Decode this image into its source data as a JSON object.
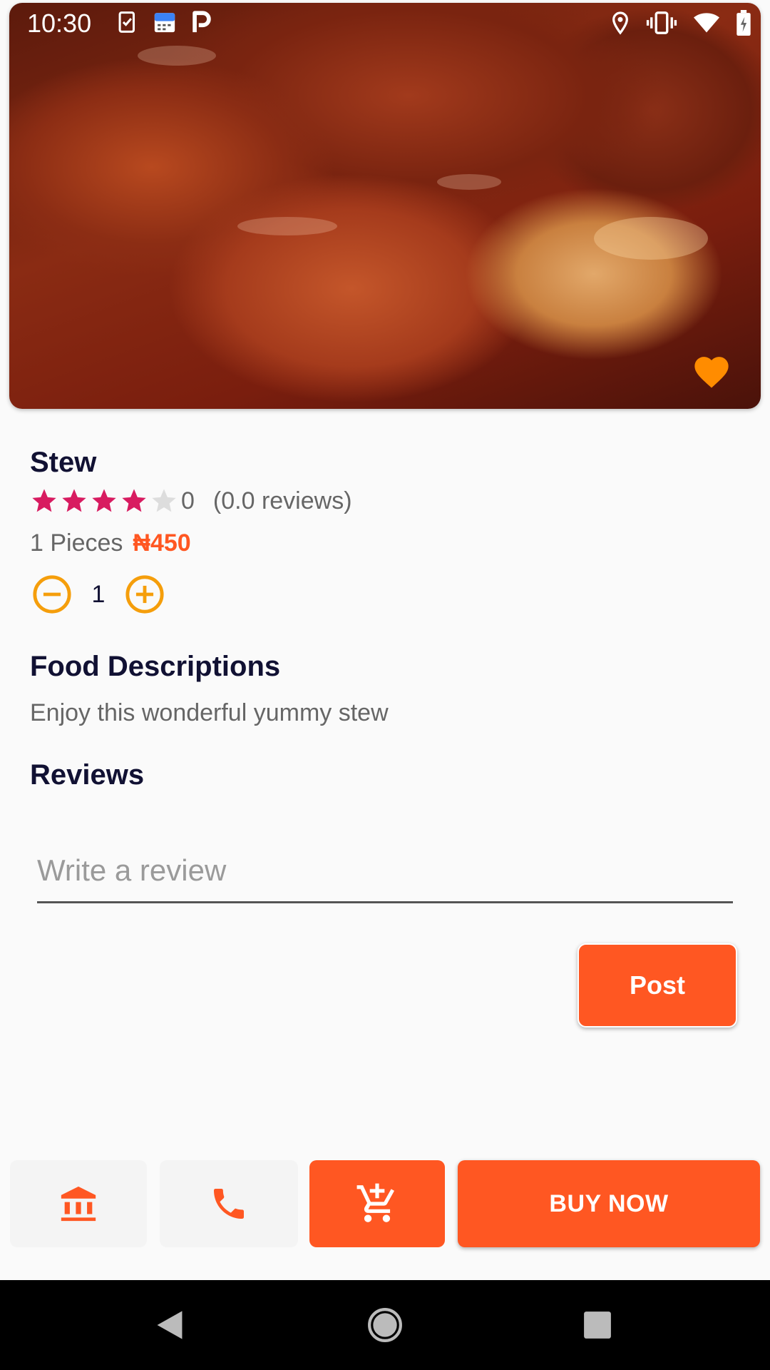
{
  "status_bar": {
    "time": "10:30"
  },
  "product": {
    "name": "Stew",
    "rating_value": "0",
    "rating_stars": 4,
    "reviews_count": "(0.0 reviews)",
    "pieces": "1 Pieces",
    "price": "₦450",
    "quantity": "1",
    "favorite_color": "#ff8c00"
  },
  "description": {
    "heading": "Food Descriptions",
    "text": "Enjoy this wonderful yummy stew"
  },
  "reviews": {
    "heading": "Reviews",
    "input_placeholder": "Write a review",
    "post_label": "Post"
  },
  "actions": {
    "buy_now_label": "BUY NOW",
    "icons": [
      "bank-icon",
      "phone-icon",
      "add-to-cart-icon"
    ]
  },
  "colors": {
    "accent": "#ff5722",
    "star": "#d81b60",
    "qty_icon": "#f59e0b",
    "heading": "#111133"
  }
}
